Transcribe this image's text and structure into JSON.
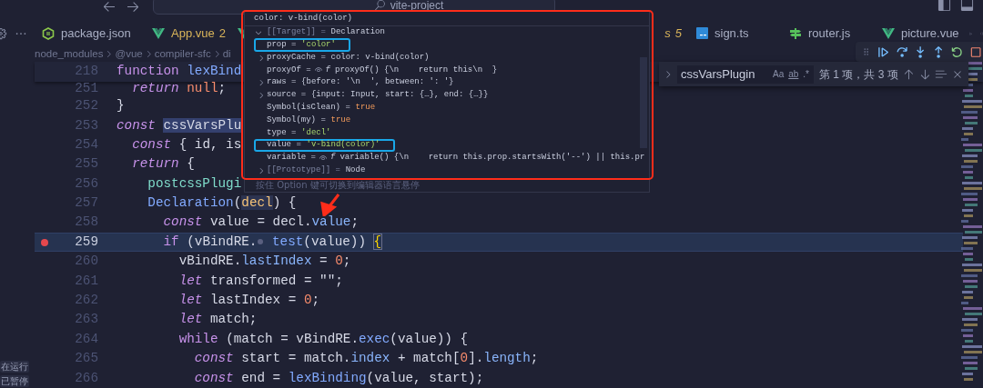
{
  "title_bar": {
    "project": "vite-project"
  },
  "tabs": [
    {
      "label": "package.json",
      "kind": "json",
      "italic": false
    },
    {
      "label": "App.vue",
      "kind": "vue",
      "problems": "2",
      "italic": false
    },
    {
      "label": "s",
      "kind": "vue",
      "problems": "5",
      "italic": true
    },
    {
      "label": "sign.ts",
      "kind": "ts",
      "italic": false
    },
    {
      "label": "router.js",
      "kind": "router",
      "italic": false
    },
    {
      "label": "picture.vue",
      "kind": "vue",
      "italic": false
    }
  ],
  "breadcrumb": [
    "node_modules",
    "@vue",
    "compiler-sfc",
    "di"
  ],
  "sticky_line": {
    "number": "218",
    "tokens": [
      {
        "kind": "kw2",
        "text": "function "
      },
      {
        "kind": "fn",
        "text": "lexBind"
      }
    ]
  },
  "clipped_line": {
    "number": "251",
    "tokens": [
      {
        "kind": "kw",
        "text": "  return"
      },
      {
        "kind": "num",
        "text": " null"
      },
      {
        "kind": "p",
        "text": ";"
      }
    ]
  },
  "lines": [
    {
      "number": "252",
      "current": false,
      "breakpoint": false,
      "tokens": [
        {
          "kind": "p",
          "text": "}"
        }
      ]
    },
    {
      "number": "253",
      "current": false,
      "breakpoint": false,
      "tokens": [
        {
          "kind": "kw",
          "text": "const "
        },
        {
          "kind": "match",
          "text": "cssVarsPlu"
        }
      ]
    },
    {
      "number": "254",
      "current": false,
      "breakpoint": false,
      "tokens": [
        {
          "kind": "kw",
          "text": "  const"
        },
        {
          "kind": "p",
          "text": " { id, is"
        }
      ]
    },
    {
      "number": "255",
      "current": false,
      "breakpoint": false,
      "tokens": [
        {
          "kind": "kw",
          "text": "  return"
        },
        {
          "kind": "p",
          "text": " {"
        }
      ]
    },
    {
      "number": "256",
      "current": false,
      "breakpoint": false,
      "tokens": [
        {
          "kind": "prop",
          "text": "    postcssPlugi"
        }
      ]
    },
    {
      "number": "257",
      "current": false,
      "breakpoint": false,
      "tokens": [
        {
          "kind": "fn",
          "text": "    Declaration"
        },
        {
          "kind": "p",
          "text": "("
        },
        {
          "kind": "param",
          "text": "decl"
        },
        {
          "kind": "p",
          "text": ") {"
        }
      ]
    },
    {
      "number": "258",
      "current": false,
      "breakpoint": false,
      "tokens": [
        {
          "kind": "kw",
          "text": "      const"
        },
        {
          "kind": "p",
          "text": " value = decl."
        },
        {
          "kind": "prop2",
          "text": "value"
        },
        {
          "kind": "p",
          "text": ";"
        }
      ]
    },
    {
      "number": "259",
      "current": true,
      "breakpoint": true,
      "tokens": [
        {
          "kind": "kw2",
          "text": "      if"
        },
        {
          "kind": "p",
          "text": " (vBindRE."
        },
        {
          "kind": "marker"
        },
        {
          "kind": "fn",
          "text": " test"
        },
        {
          "kind": "p",
          "text": "(value)) "
        },
        {
          "kind": "brace",
          "text": "{"
        }
      ]
    },
    {
      "number": "260",
      "current": false,
      "breakpoint": false,
      "tokens": [
        {
          "kind": "p",
          "text": "        vBindRE."
        },
        {
          "kind": "prop2",
          "text": "lastIndex"
        },
        {
          "kind": "p",
          "text": " = "
        },
        {
          "kind": "num",
          "text": "0"
        },
        {
          "kind": "p",
          "text": ";"
        }
      ]
    },
    {
      "number": "261",
      "current": false,
      "breakpoint": false,
      "tokens": [
        {
          "kind": "kw",
          "text": "        let"
        },
        {
          "kind": "p",
          "text": " transformed = "
        },
        {
          "kind": "str",
          "text": "\"\""
        },
        {
          "kind": "p",
          "text": ";"
        }
      ]
    },
    {
      "number": "262",
      "current": false,
      "breakpoint": false,
      "tokens": [
        {
          "kind": "kw",
          "text": "        let"
        },
        {
          "kind": "p",
          "text": " lastIndex = "
        },
        {
          "kind": "num",
          "text": "0"
        },
        {
          "kind": "p",
          "text": ";"
        }
      ]
    },
    {
      "number": "263",
      "current": false,
      "breakpoint": false,
      "tokens": [
        {
          "kind": "kw",
          "text": "        let"
        },
        {
          "kind": "p",
          "text": " match;"
        }
      ]
    },
    {
      "number": "264",
      "current": false,
      "breakpoint": false,
      "tokens": [
        {
          "kind": "kw2",
          "text": "        while"
        },
        {
          "kind": "p",
          "text": " (match = vBindRE."
        },
        {
          "kind": "fn",
          "text": "exec"
        },
        {
          "kind": "p",
          "text": "(value)) {"
        }
      ]
    },
    {
      "number": "265",
      "current": false,
      "breakpoint": false,
      "tokens": [
        {
          "kind": "kw",
          "text": "          const"
        },
        {
          "kind": "p",
          "text": " start = match."
        },
        {
          "kind": "prop2",
          "text": "index"
        },
        {
          "kind": "p",
          "text": " + match["
        },
        {
          "kind": "num",
          "text": "0"
        },
        {
          "kind": "p",
          "text": "]."
        },
        {
          "kind": "prop2",
          "text": "length"
        },
        {
          "kind": "p",
          "text": ";"
        }
      ]
    },
    {
      "number": "266",
      "current": false,
      "breakpoint": false,
      "tokens": [
        {
          "kind": "kw",
          "text": "          const"
        },
        {
          "kind": "p",
          "text": " end = "
        },
        {
          "kind": "fn",
          "text": "lexBinding"
        },
        {
          "kind": "p",
          "text": "(value, start);"
        }
      ]
    }
  ],
  "hover": {
    "header": "color: v-bind(color)",
    "root": {
      "name": "[[Target]] =",
      "value": "Declaration",
      "dim": true,
      "expanded": true,
      "children": [
        {
          "name": "prop =",
          "value": "'color'",
          "kind": "string",
          "dim": false,
          "expandable": false,
          "circled": true
        },
        {
          "name": "proxyCache =",
          "value": "color: v-bind(color)",
          "kind": "object",
          "dim": false,
          "expandable": true,
          "circled": false
        },
        {
          "name": "proxyOf =",
          "value": "proxyOf() {\\n    return this\\n  }",
          "prefix": "f",
          "kind": "function",
          "dim": false,
          "expandable": false,
          "circled": false
        },
        {
          "name": "raws =",
          "value": "{before: '\\n  ', between: ': '}",
          "kind": "object",
          "dim": false,
          "expandable": true,
          "circled": false
        },
        {
          "name": "source =",
          "value": "{input: Input, start: {…}, end: {…}}",
          "kind": "object",
          "dim": false,
          "expandable": true,
          "circled": false
        },
        {
          "name": "Symbol(isClean) =",
          "value": "true",
          "kind": "boolean",
          "dim": false,
          "expandable": false,
          "circled": false
        },
        {
          "name": "Symbol(my) =",
          "value": "true",
          "kind": "boolean",
          "dim": false,
          "expandable": false,
          "circled": false
        },
        {
          "name": "type =",
          "value": "'decl'",
          "kind": "string",
          "dim": false,
          "expandable": false,
          "circled": false
        },
        {
          "name": "value =",
          "value": "'v-bind(color)'",
          "kind": "string",
          "dim": false,
          "expandable": false,
          "circled": true
        },
        {
          "name": "variable =",
          "value": "variable() {\\n    return this.prop.startsWith('--') || this.pr",
          "prefix": "f",
          "kind": "function",
          "dim": false,
          "expandable": false,
          "circled": false
        },
        {
          "name": "[[Prototype]] =",
          "value": "Node",
          "kind": "object",
          "dim": true,
          "expandable": true,
          "circled": false
        }
      ]
    },
    "hint": "按住 Option 键可切换到编辑器语言悬停"
  },
  "find": {
    "query": "cssVarsPlugin",
    "toggles": [
      {
        "label": "Aa",
        "on": false
      },
      {
        "label": "ab",
        "on": false
      },
      {
        "label": ".*",
        "on": false
      }
    ],
    "result": "第 1 项，共 3 项"
  },
  "sessions": [
    {
      "label": "在运行"
    },
    {
      "label": "已暂停"
    }
  ]
}
